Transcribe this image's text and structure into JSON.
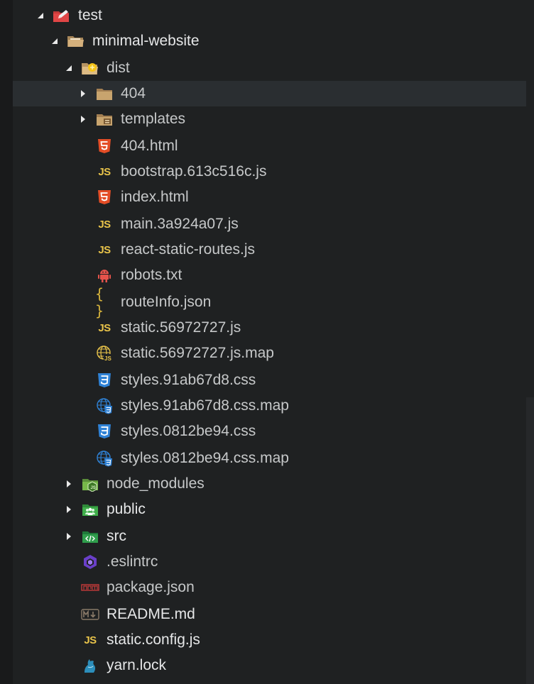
{
  "colors": {
    "background": "#1f2122",
    "selected_row": "#2a2e31",
    "text": "#c6c8c9",
    "folder": "#c8a46e",
    "html_icon": "#e44d26",
    "js_icon": "#e8c34a",
    "css_icon": "#2f82d6",
    "node_folder": "#77b84a"
  },
  "tree": {
    "root": {
      "label": "test",
      "icon": "test-folder-icon",
      "expanded": true
    },
    "project": {
      "label": "minimal-website",
      "icon": "open-folder-icon",
      "expanded": true
    },
    "dist": {
      "label": "dist",
      "icon": "dist-folder-icon",
      "expanded": true
    },
    "dist_items": [
      {
        "label": "404",
        "icon": "folder-icon",
        "expandable": true,
        "selected": true
      },
      {
        "label": "templates",
        "icon": "templates-folder-icon",
        "expandable": true
      },
      {
        "label": "404.html",
        "icon": "html5-icon"
      },
      {
        "label": "bootstrap.613c516c.js",
        "icon": "js-icon"
      },
      {
        "label": "index.html",
        "icon": "html5-icon"
      },
      {
        "label": "main.3a924a07.js",
        "icon": "js-icon"
      },
      {
        "label": "react-static-routes.js",
        "icon": "js-icon"
      },
      {
        "label": "robots.txt",
        "icon": "robot-icon"
      },
      {
        "label": "routeInfo.json",
        "icon": "json-braces-icon"
      },
      {
        "label": "static.56972727.js",
        "icon": "js-icon"
      },
      {
        "label": "static.56972727.js.map",
        "icon": "js-map-icon"
      },
      {
        "label": "styles.91ab67d8.css",
        "icon": "css3-icon"
      },
      {
        "label": "styles.91ab67d8.css.map",
        "icon": "css-map-icon"
      },
      {
        "label": "styles.0812be94.css",
        "icon": "css3-icon"
      },
      {
        "label": "styles.0812be94.css.map",
        "icon": "css-map-icon"
      }
    ],
    "project_items": [
      {
        "label": "node_modules",
        "icon": "node-folder-icon",
        "expandable": true
      },
      {
        "label": "public",
        "icon": "public-folder-icon",
        "expandable": true
      },
      {
        "label": "src",
        "icon": "src-folder-icon",
        "expandable": true
      },
      {
        "label": ".eslintrc",
        "icon": "eslint-icon"
      },
      {
        "label": "package.json",
        "icon": "npm-icon"
      },
      {
        "label": "README.md",
        "icon": "markdown-icon"
      },
      {
        "label": "static.config.js",
        "icon": "js-icon"
      },
      {
        "label": "yarn.lock",
        "icon": "yarn-icon"
      }
    ]
  },
  "icon_text": {
    "js": "JS",
    "braces": "{ }"
  }
}
